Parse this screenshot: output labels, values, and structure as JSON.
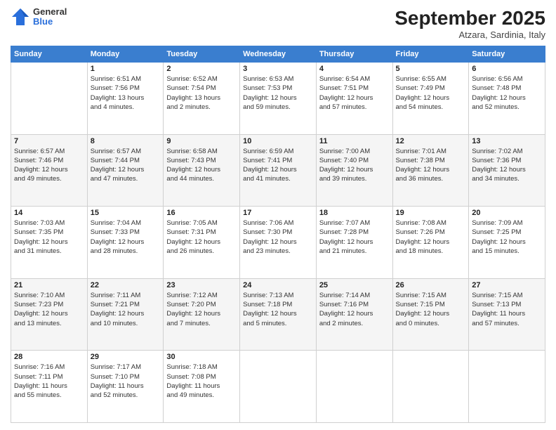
{
  "logo": {
    "general": "General",
    "blue": "Blue"
  },
  "header": {
    "month_year": "September 2025",
    "location": "Atzara, Sardinia, Italy"
  },
  "weekdays": [
    "Sunday",
    "Monday",
    "Tuesday",
    "Wednesday",
    "Thursday",
    "Friday",
    "Saturday"
  ],
  "weeks": [
    [
      {
        "day": "",
        "info": ""
      },
      {
        "day": "1",
        "info": "Sunrise: 6:51 AM\nSunset: 7:56 PM\nDaylight: 13 hours\nand 4 minutes."
      },
      {
        "day": "2",
        "info": "Sunrise: 6:52 AM\nSunset: 7:54 PM\nDaylight: 13 hours\nand 2 minutes."
      },
      {
        "day": "3",
        "info": "Sunrise: 6:53 AM\nSunset: 7:53 PM\nDaylight: 12 hours\nand 59 minutes."
      },
      {
        "day": "4",
        "info": "Sunrise: 6:54 AM\nSunset: 7:51 PM\nDaylight: 12 hours\nand 57 minutes."
      },
      {
        "day": "5",
        "info": "Sunrise: 6:55 AM\nSunset: 7:49 PM\nDaylight: 12 hours\nand 54 minutes."
      },
      {
        "day": "6",
        "info": "Sunrise: 6:56 AM\nSunset: 7:48 PM\nDaylight: 12 hours\nand 52 minutes."
      }
    ],
    [
      {
        "day": "7",
        "info": "Sunrise: 6:57 AM\nSunset: 7:46 PM\nDaylight: 12 hours\nand 49 minutes."
      },
      {
        "day": "8",
        "info": "Sunrise: 6:57 AM\nSunset: 7:44 PM\nDaylight: 12 hours\nand 47 minutes."
      },
      {
        "day": "9",
        "info": "Sunrise: 6:58 AM\nSunset: 7:43 PM\nDaylight: 12 hours\nand 44 minutes."
      },
      {
        "day": "10",
        "info": "Sunrise: 6:59 AM\nSunset: 7:41 PM\nDaylight: 12 hours\nand 41 minutes."
      },
      {
        "day": "11",
        "info": "Sunrise: 7:00 AM\nSunset: 7:40 PM\nDaylight: 12 hours\nand 39 minutes."
      },
      {
        "day": "12",
        "info": "Sunrise: 7:01 AM\nSunset: 7:38 PM\nDaylight: 12 hours\nand 36 minutes."
      },
      {
        "day": "13",
        "info": "Sunrise: 7:02 AM\nSunset: 7:36 PM\nDaylight: 12 hours\nand 34 minutes."
      }
    ],
    [
      {
        "day": "14",
        "info": "Sunrise: 7:03 AM\nSunset: 7:35 PM\nDaylight: 12 hours\nand 31 minutes."
      },
      {
        "day": "15",
        "info": "Sunrise: 7:04 AM\nSunset: 7:33 PM\nDaylight: 12 hours\nand 28 minutes."
      },
      {
        "day": "16",
        "info": "Sunrise: 7:05 AM\nSunset: 7:31 PM\nDaylight: 12 hours\nand 26 minutes."
      },
      {
        "day": "17",
        "info": "Sunrise: 7:06 AM\nSunset: 7:30 PM\nDaylight: 12 hours\nand 23 minutes."
      },
      {
        "day": "18",
        "info": "Sunrise: 7:07 AM\nSunset: 7:28 PM\nDaylight: 12 hours\nand 21 minutes."
      },
      {
        "day": "19",
        "info": "Sunrise: 7:08 AM\nSunset: 7:26 PM\nDaylight: 12 hours\nand 18 minutes."
      },
      {
        "day": "20",
        "info": "Sunrise: 7:09 AM\nSunset: 7:25 PM\nDaylight: 12 hours\nand 15 minutes."
      }
    ],
    [
      {
        "day": "21",
        "info": "Sunrise: 7:10 AM\nSunset: 7:23 PM\nDaylight: 12 hours\nand 13 minutes."
      },
      {
        "day": "22",
        "info": "Sunrise: 7:11 AM\nSunset: 7:21 PM\nDaylight: 12 hours\nand 10 minutes."
      },
      {
        "day": "23",
        "info": "Sunrise: 7:12 AM\nSunset: 7:20 PM\nDaylight: 12 hours\nand 7 minutes."
      },
      {
        "day": "24",
        "info": "Sunrise: 7:13 AM\nSunset: 7:18 PM\nDaylight: 12 hours\nand 5 minutes."
      },
      {
        "day": "25",
        "info": "Sunrise: 7:14 AM\nSunset: 7:16 PM\nDaylight: 12 hours\nand 2 minutes."
      },
      {
        "day": "26",
        "info": "Sunrise: 7:15 AM\nSunset: 7:15 PM\nDaylight: 12 hours\nand 0 minutes."
      },
      {
        "day": "27",
        "info": "Sunrise: 7:15 AM\nSunset: 7:13 PM\nDaylight: 11 hours\nand 57 minutes."
      }
    ],
    [
      {
        "day": "28",
        "info": "Sunrise: 7:16 AM\nSunset: 7:11 PM\nDaylight: 11 hours\nand 55 minutes."
      },
      {
        "day": "29",
        "info": "Sunrise: 7:17 AM\nSunset: 7:10 PM\nDaylight: 11 hours\nand 52 minutes."
      },
      {
        "day": "30",
        "info": "Sunrise: 7:18 AM\nSunset: 7:08 PM\nDaylight: 11 hours\nand 49 minutes."
      },
      {
        "day": "",
        "info": ""
      },
      {
        "day": "",
        "info": ""
      },
      {
        "day": "",
        "info": ""
      },
      {
        "day": "",
        "info": ""
      }
    ]
  ]
}
